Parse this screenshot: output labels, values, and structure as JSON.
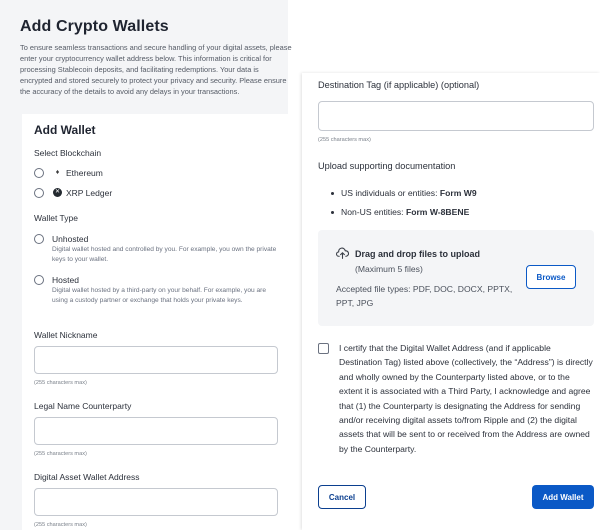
{
  "page": {
    "title": "Add Crypto Wallets",
    "intro": "To ensure seamless transactions and secure handling of your digital assets, please enter your cryptocurrency wallet address below. This information is critical for processing Stablecoin deposits, and facilitating redemptions. Your data is encrypted and stored securely to protect your privacy and security. Please ensure the accuracy of the details to avoid any delays in your transactions."
  },
  "wallet_form": {
    "title": "Add Wallet",
    "blockchain": {
      "label": "Select Blockchain",
      "options": [
        {
          "label": "Ethereum",
          "icon": "ethereum-icon"
        },
        {
          "label": "XRP Ledger",
          "icon": "xrp-icon"
        }
      ]
    },
    "wallet_type": {
      "label": "Wallet Type",
      "options": [
        {
          "label": "Unhosted",
          "description": "Digital wallet hosted and controlled by you. For example, you own the private keys to your wallet."
        },
        {
          "label": "Hosted",
          "description": "Digital wallet hosted by a third-party on your behalf. For example, you are using a custody partner or exchange that holds your private keys."
        }
      ]
    },
    "nickname": {
      "label": "Wallet Nickname",
      "value": "",
      "hint": "(255 characters max)"
    },
    "legal_name": {
      "label": "Legal Name Counterparty",
      "value": "",
      "hint": "(255 characters max)"
    },
    "address": {
      "label": "Digital Asset Wallet Address",
      "value": "",
      "hint": "(255 characters max)"
    },
    "destination_tag": {
      "label": "Destination Tag (if applicable) (optional)",
      "value": "",
      "hint": "(255 characters max)"
    },
    "documentation": {
      "label": "Upload supporting documentation",
      "items": [
        {
          "text": "US individuals or entities: ",
          "form": "Form W9"
        },
        {
          "text": "Non-US entities: ",
          "form": "Form W-8BENE"
        }
      ]
    },
    "dropzone": {
      "title": "Drag and drop files to upload",
      "subtitle": "(Maximum 5 files)",
      "types": "Accepted file types: PDF, DOC, DOCX, PPTX, PPT, JPG",
      "browse_label": "Browse"
    },
    "certify_text": "I certify that the Digital Wallet Address (and if applicable Destination Tag) listed above (collectively, the “Address”) is directly and wholly owned by the Counterparty listed above, or to the extent it is associated with a Third Party, I acknowledge and agree that (1) the Counterparty is designating the Address for sending and/or receiving digital assets to/from Ripple and (2) the digital assets that will be sent to or received from the Address are owned by the Counterparty.",
    "cancel_label": "Cancel",
    "submit_label": "Add Wallet"
  },
  "colors": {
    "primary": "#0b59c6",
    "panel_bg": "#f4f5f7"
  }
}
